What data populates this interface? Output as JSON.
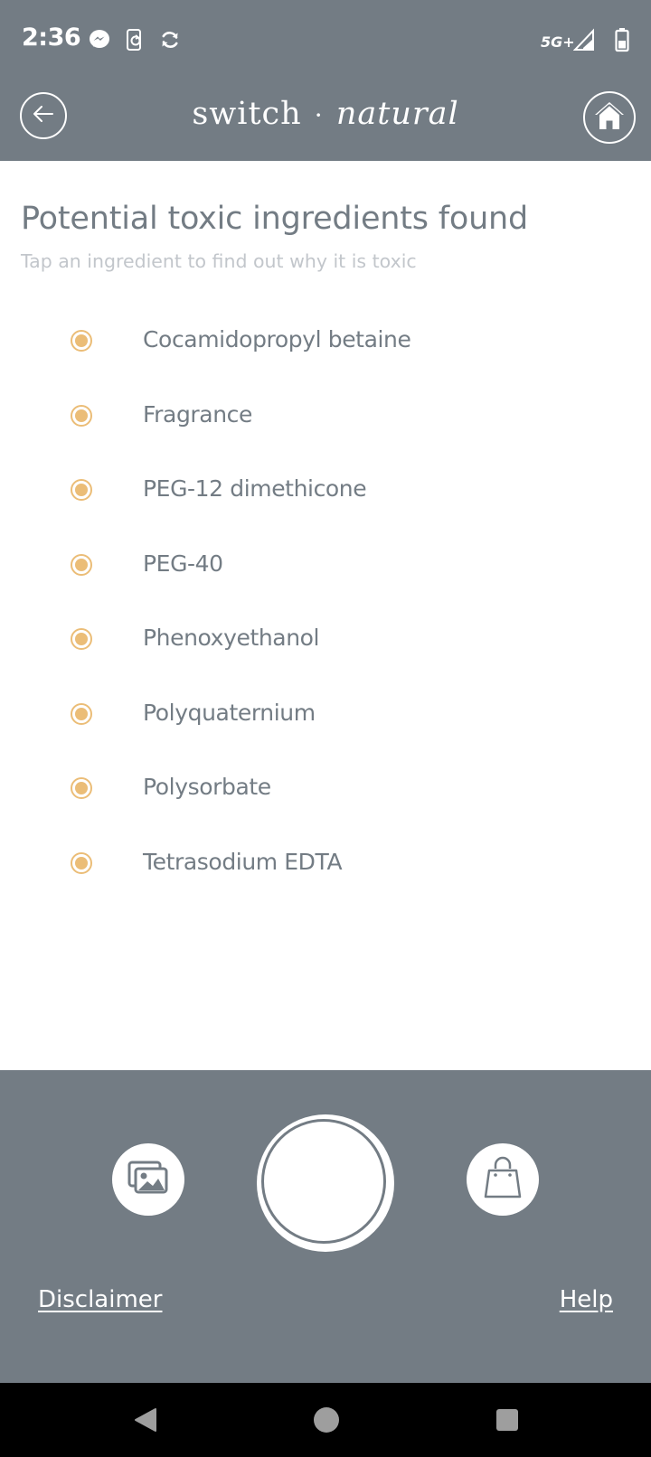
{
  "status_bar": {
    "time": "2:36",
    "network": "5G+",
    "icons": [
      "messenger-icon",
      "phone-sync-icon",
      "sync-icon",
      "signal-icon",
      "battery-icon"
    ]
  },
  "header": {
    "brand_first": "switch",
    "brand_dot": "·",
    "brand_second": "natural",
    "back_icon": "back-arrow-icon",
    "home_icon": "home-icon"
  },
  "content": {
    "title": "Potential toxic ingredients found",
    "subtitle": "Tap an ingredient to find out why it is toxic",
    "ingredients": [
      "Cocamidopropyl betaine",
      "Fragrance",
      "PEG-12 dimethicone",
      "PEG-40",
      "Phenoxyethanol",
      "Polyquaternium",
      "Polysorbate",
      "Tetrasodium EDTA"
    ]
  },
  "bottom": {
    "gallery_icon": "gallery-icon",
    "shutter_icon": "camera-shutter-button",
    "shop_icon": "shopping-bag-icon",
    "disclaimer": "Disclaimer",
    "help": "Help"
  },
  "nav": {
    "icons": [
      "back-triangle-icon",
      "home-circle-icon",
      "recents-square-icon"
    ]
  },
  "colors": {
    "bar": "#737c84",
    "accent": "#ebbd77",
    "title_text": "#737c84",
    "subtitle_text": "#c2c6cb",
    "white": "#ffffff"
  }
}
